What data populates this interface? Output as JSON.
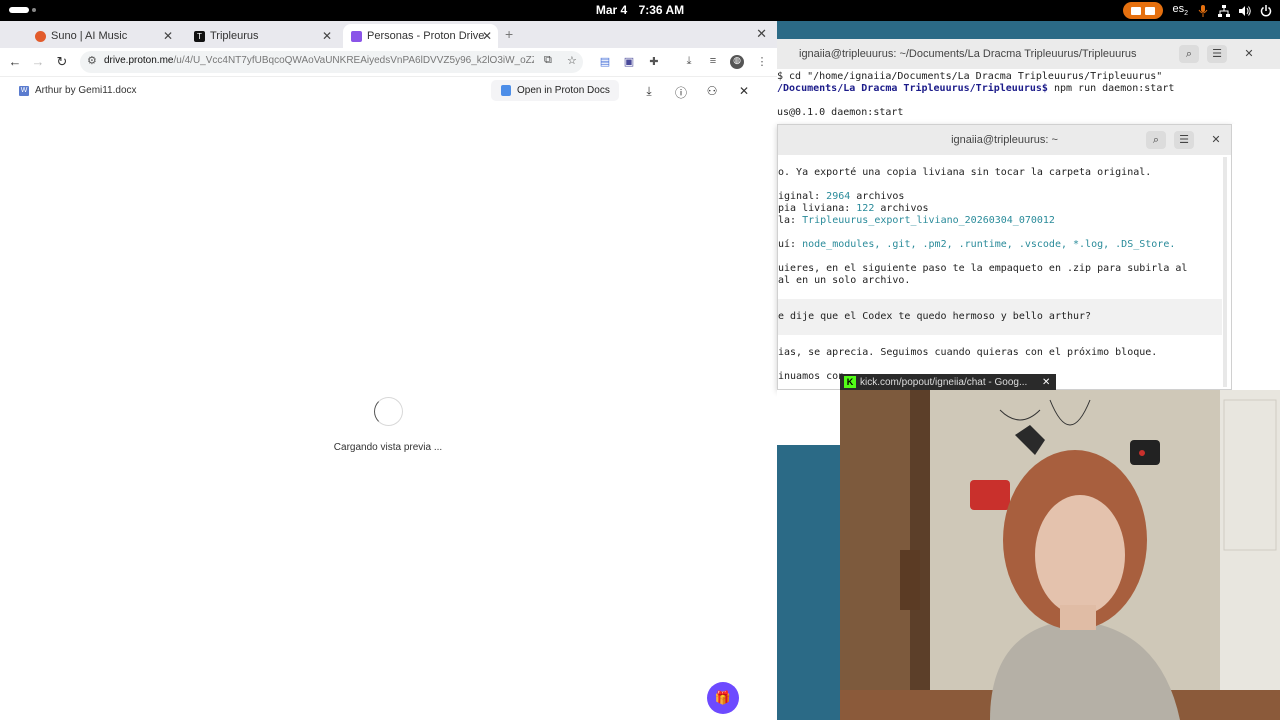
{
  "topbar": {
    "date": "Mar 4",
    "time": "7:36 AM",
    "keyboard_layout": "es",
    "keyboard_sub": "2",
    "tray_icons": [
      "recording-indicator",
      "microphone-icon",
      "network-icon",
      "volume-icon",
      "power-icon"
    ]
  },
  "browser": {
    "tabs": [
      {
        "label": "Suno | AI Music",
        "icon": "suno-favicon",
        "color": "#e25b2b"
      },
      {
        "label": "Tripleurus",
        "icon": "tripleurus-favicon",
        "color": "#111111"
      },
      {
        "label": "Personas - Proton Drive",
        "icon": "proton-drive-favicon",
        "color": "#8a54e8",
        "active": true
      }
    ],
    "url_host": "drive.proton.me",
    "url_path": "/u/4/U_Vcc4NT7yfUBqcoQWAoVaUNKREAiyedsVnPA6lDVVZ5y96_k2lO3iW_oZZWAs...",
    "viewer": {
      "document_name": "Arthur by Gemi11.docx",
      "open_button": "Open in Proton Docs",
      "loading_text": "Cargando vista previa ..."
    },
    "accent": "#6d4aff"
  },
  "terminal_back": {
    "title": "ignaiia@tripleuurus: ~/Documents/La Dracma Tripleuurus/Tripleuurus",
    "lines": [
      "$ cd \"/home/ignaiia/Documents/La Dracma Tripleuurus/Tripleuurus\"",
      "npm run daemon:start",
      "us@0.1.0 daemon:start"
    ],
    "prompt_path": "/Documents/La Dracma Tripleuurus/Tripleuurus$"
  },
  "terminal_front": {
    "title": "ignaiia@tripleuurus: ~",
    "lines": {
      "l1": "o. Ya exporté una copia liviana sin tocar la carpeta original.",
      "l2_label": "iginal: ",
      "l2_num": "2964",
      "l2_rest": " archivos",
      "l3_label": "pia liviana: ",
      "l3_num": "122",
      "l3_rest": " archivos",
      "l4_label": "la: ",
      "l4_val": "Tripleuurus_export_liviano_20260304_070012",
      "l5_label": "uí: ",
      "l5_items": "node_modules, .git, .pm2, .runtime, .vscode, *.log, .DS_Store.",
      "l6": "uieres, en el siguiente paso te la empaqueto en .zip para subirla al",
      "l7": "al en un solo archivo.",
      "l8": "e dije que el Codex te quedo hermoso y bello arthur?",
      "l9": "ias, se aprecia. Seguimos cuando quieras con el próximo bloque.",
      "l10": "inuamos con"
    }
  },
  "popup": {
    "title": "kick.com/popout/igneiia/chat - Goog..."
  }
}
